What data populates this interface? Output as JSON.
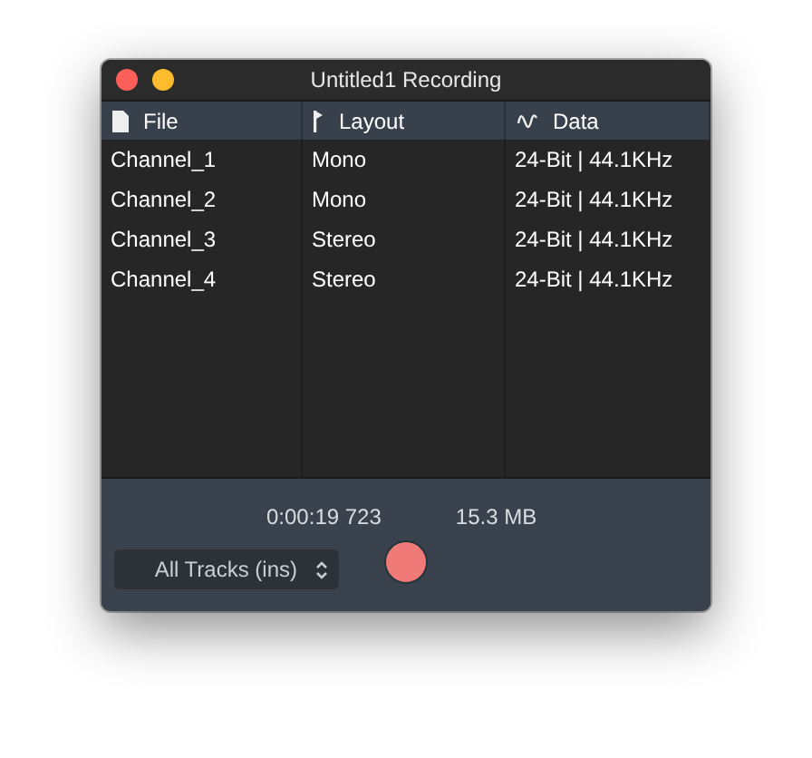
{
  "window": {
    "title": "Untitled1 Recording"
  },
  "table": {
    "columns": [
      "File",
      "Layout",
      "Data"
    ],
    "rows": [
      {
        "file": "Channel_1",
        "layout": "Mono",
        "data": "24-Bit | 44.1KHz"
      },
      {
        "file": "Channel_2",
        "layout": "Mono",
        "data": "24-Bit | 44.1KHz"
      },
      {
        "file": "Channel_3",
        "layout": "Stereo",
        "data": "24-Bit | 44.1KHz"
      },
      {
        "file": "Channel_4",
        "layout": "Stereo",
        "data": "24-Bit | 44.1KHz"
      }
    ]
  },
  "footer": {
    "elapsed": "0:00:19 723",
    "size": "15.3 MB",
    "source": {
      "value": "All Tracks (ins)"
    }
  }
}
